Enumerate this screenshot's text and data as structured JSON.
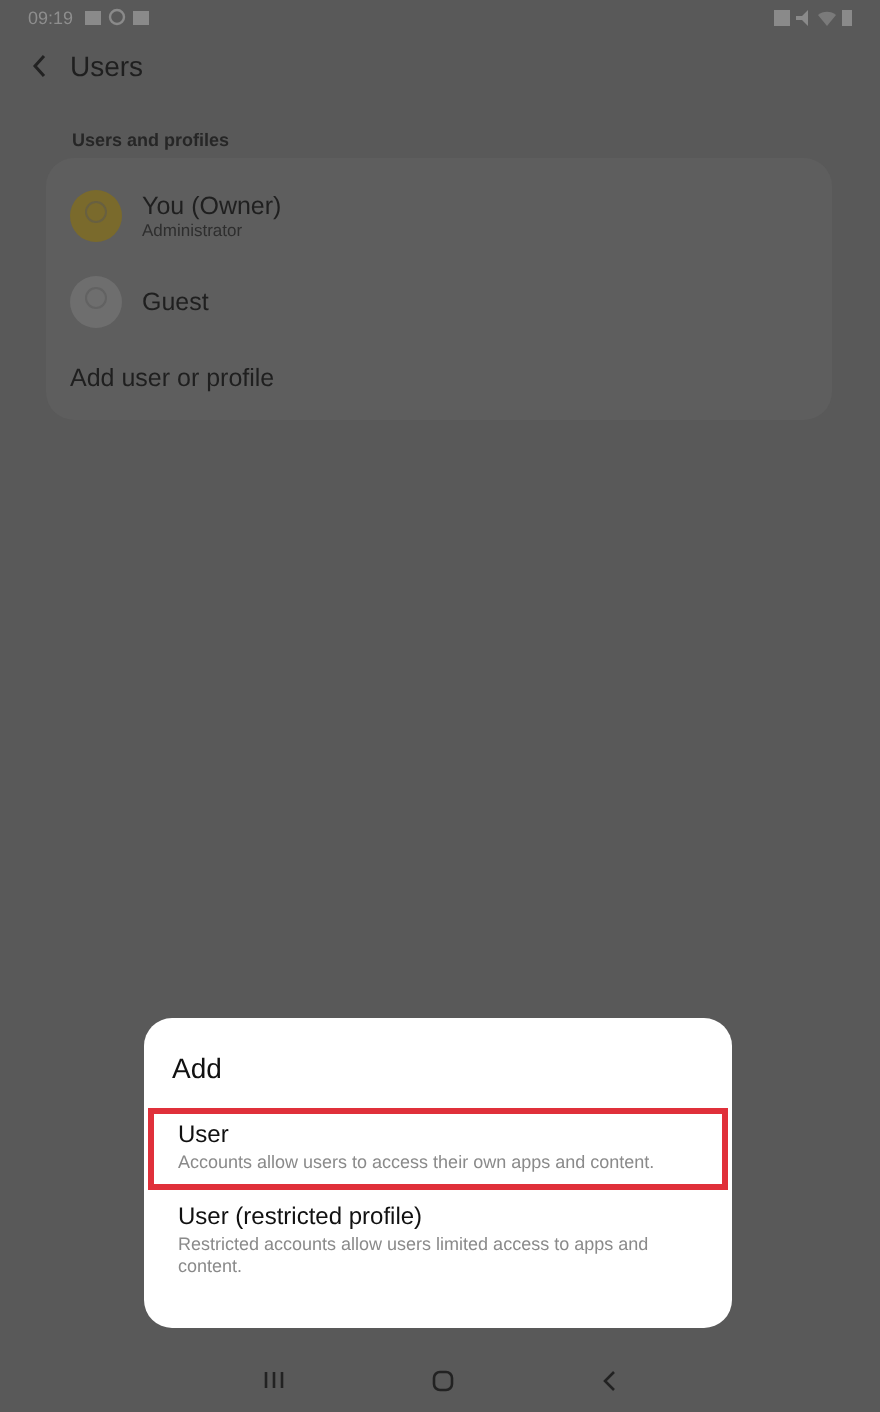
{
  "status_bar": {
    "time": "09:19"
  },
  "header": {
    "title": "Users"
  },
  "section": {
    "title": "Users and profiles"
  },
  "users": [
    {
      "name": "You (Owner)",
      "role": "Administrator",
      "color": "#7a6a2c"
    },
    {
      "name": "Guest",
      "color": "#6e6e6e"
    }
  ],
  "add_item": {
    "label": "Add user or profile"
  },
  "dialog": {
    "title": "Add",
    "options": [
      {
        "title": "User",
        "description": "Accounts allow users to access their own apps and content.",
        "selected": true
      },
      {
        "title": "User (restricted profile)",
        "description": "Restricted accounts allow users limited access to apps and content.",
        "selected": false
      }
    ]
  }
}
